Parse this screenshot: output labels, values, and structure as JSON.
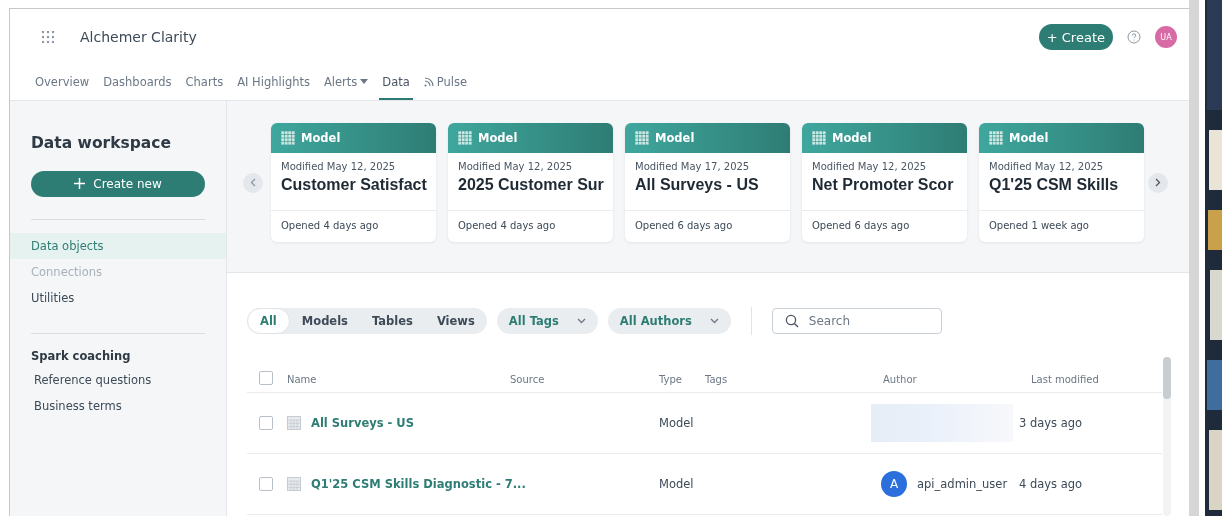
{
  "app": {
    "title": "Alchemer Clarity",
    "create_label": "+ Create",
    "avatar": "UA"
  },
  "nav": [
    {
      "label": "Overview",
      "selected": false,
      "kind": "plain"
    },
    {
      "label": "Dashboards",
      "selected": false,
      "kind": "plain"
    },
    {
      "label": "Charts",
      "selected": false,
      "kind": "plain"
    },
    {
      "label": "AI Highlights",
      "selected": false,
      "kind": "plain"
    },
    {
      "label": "Alerts",
      "selected": false,
      "kind": "dropdown"
    },
    {
      "label": "Data",
      "selected": true,
      "kind": "plain"
    },
    {
      "label": "Pulse",
      "selected": false,
      "kind": "feed"
    }
  ],
  "sidebar": {
    "title": "Data workspace",
    "create_button": "Create new",
    "items": [
      {
        "label": "Data objects",
        "selected": true,
        "disabled": false
      },
      {
        "label": "Connections",
        "selected": false,
        "disabled": true
      },
      {
        "label": "Utilities",
        "selected": false,
        "disabled": false
      }
    ],
    "section": {
      "title": "Spark coaching",
      "items": [
        "Reference questions",
        "Business terms"
      ]
    }
  },
  "cards": [
    {
      "type": "Model",
      "modified": "Modified May 12, 2025",
      "title": "Customer Satisfact",
      "opened": "Opened 4 days ago"
    },
    {
      "type": "Model",
      "modified": "Modified May 12, 2025",
      "title": "2025 Customer Sur",
      "opened": "Opened 4 days ago"
    },
    {
      "type": "Model",
      "modified": "Modified May 17, 2025",
      "title": "All Surveys - US",
      "opened": "Opened 6 days ago"
    },
    {
      "type": "Model",
      "modified": "Modified May 12, 2025",
      "title": "Net Promoter Scor",
      "opened": "Opened 6 days ago"
    },
    {
      "type": "Model",
      "modified": "Modified May 12, 2025",
      "title": "Q1'25 CSM Skills",
      "opened": "Opened 1 week ago"
    }
  ],
  "filters": {
    "segments": [
      {
        "label": "All",
        "selected": true
      },
      {
        "label": "Models",
        "selected": false
      },
      {
        "label": "Tables",
        "selected": false
      },
      {
        "label": "Views",
        "selected": false
      }
    ],
    "dropdowns": [
      "All Tags",
      "All Authors"
    ],
    "search": {
      "placeholder": "Search"
    }
  },
  "table": {
    "select_all_checked": false,
    "columns": [
      "Name",
      "Source",
      "Type",
      "Tags",
      "Author",
      "Last modified"
    ],
    "rows": [
      {
        "checked": false,
        "name": "All Surveys - US",
        "type": "Model",
        "author_redacted": true,
        "last_modified": "3 days ago"
      },
      {
        "checked": false,
        "name": "Q1'25 CSM Skills Diagnostic - 7...",
        "type": "Model",
        "author_redacted": false,
        "author_initial": "A",
        "author": "api_admin_user",
        "last_modified": "4 days ago"
      }
    ]
  }
}
